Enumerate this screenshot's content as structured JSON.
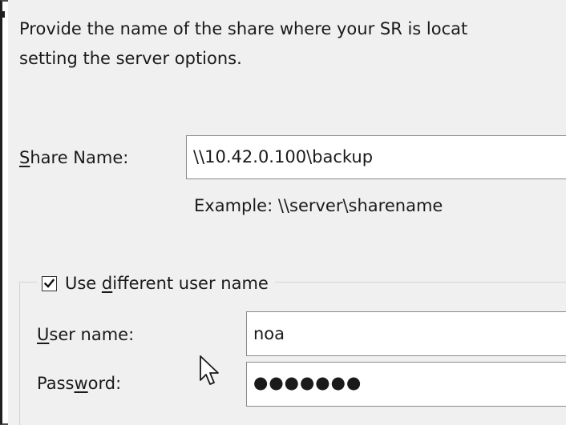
{
  "description": {
    "line1": "Provide the name of the share where your SR is locat",
    "line2": "setting the server options."
  },
  "share": {
    "label_accel": "S",
    "label_rest": "hare Name:",
    "value": "\\\\10.42.0.100\\backup",
    "example": "Example: \\\\server\\sharename"
  },
  "credentials": {
    "checkbox": {
      "checked": true,
      "label_prefix": "Use ",
      "label_accel": "d",
      "label_rest": "ifferent user name"
    },
    "username": {
      "label_accel": "U",
      "label_rest": "ser name:",
      "value": "noa"
    },
    "password": {
      "label_prefix": "Pass",
      "label_accel": "w",
      "label_rest": "ord:",
      "value": "●●●●●●●"
    }
  },
  "icons": {
    "checkmark": "checkmark-icon",
    "cursor": "mouse-pointer-icon"
  }
}
